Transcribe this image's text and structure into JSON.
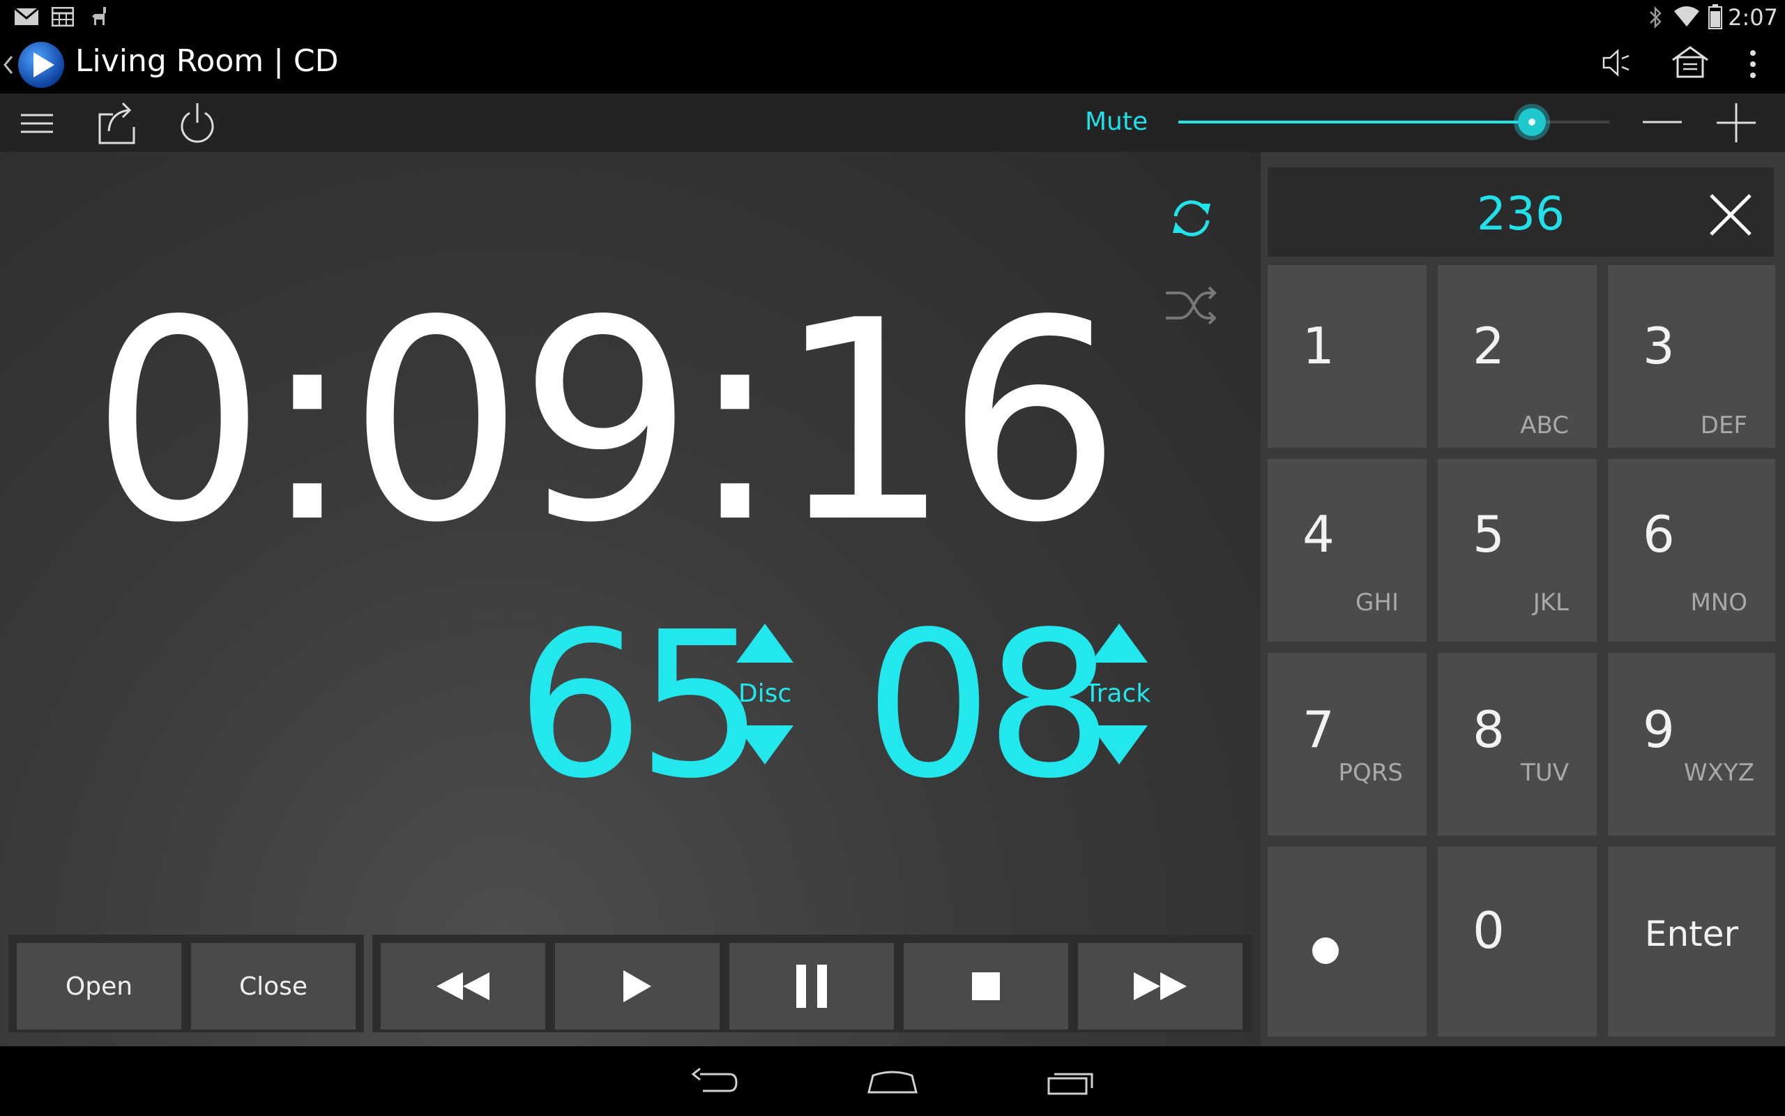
{
  "status_bar": {
    "time": "2:07",
    "left_icons": [
      "mail-icon",
      "calendar-icon",
      "llama-icon"
    ],
    "right_icons": [
      "bluetooth-icon",
      "wifi-icon",
      "battery-icon"
    ]
  },
  "action_bar": {
    "title": "Living Room | CD",
    "icons": [
      "back-chevron-icon",
      "app-logo-icon",
      "speaker-icon",
      "home-icon",
      "overflow-menu-icon"
    ]
  },
  "toolbar": {
    "icons": [
      "menu-icon",
      "share-icon",
      "power-icon"
    ],
    "mute_label": "Mute",
    "volume_level": 0.82,
    "volume_down_label": "−",
    "volume_up_label": "+"
  },
  "player": {
    "elapsed_time": "0:09:16",
    "disc_number": "65",
    "disc_label": "Disc",
    "track_number": "08",
    "track_label": "Track",
    "repeat_active": true,
    "shuffle_active": false
  },
  "buttons": {
    "open": "Open",
    "close": "Close",
    "transport": [
      "rewind-icon",
      "play-icon",
      "pause-icon",
      "stop-icon",
      "fast-forward-icon"
    ]
  },
  "keypad": {
    "entry": "236",
    "keys": [
      {
        "digit": "1",
        "letters": ""
      },
      {
        "digit": "2",
        "letters": "ABC"
      },
      {
        "digit": "3",
        "letters": "DEF"
      },
      {
        "digit": "4",
        "letters": "GHI"
      },
      {
        "digit": "5",
        "letters": "JKL"
      },
      {
        "digit": "6",
        "letters": "MNO"
      },
      {
        "digit": "7",
        "letters": "PQRS"
      },
      {
        "digit": "8",
        "letters": "TUV"
      },
      {
        "digit": "9",
        "letters": "WXYZ"
      }
    ],
    "dot_key": "•",
    "zero_key": "0",
    "enter_key": "Enter"
  },
  "colors": {
    "accent": "#22e8ee",
    "background": "#2b2b2b"
  }
}
